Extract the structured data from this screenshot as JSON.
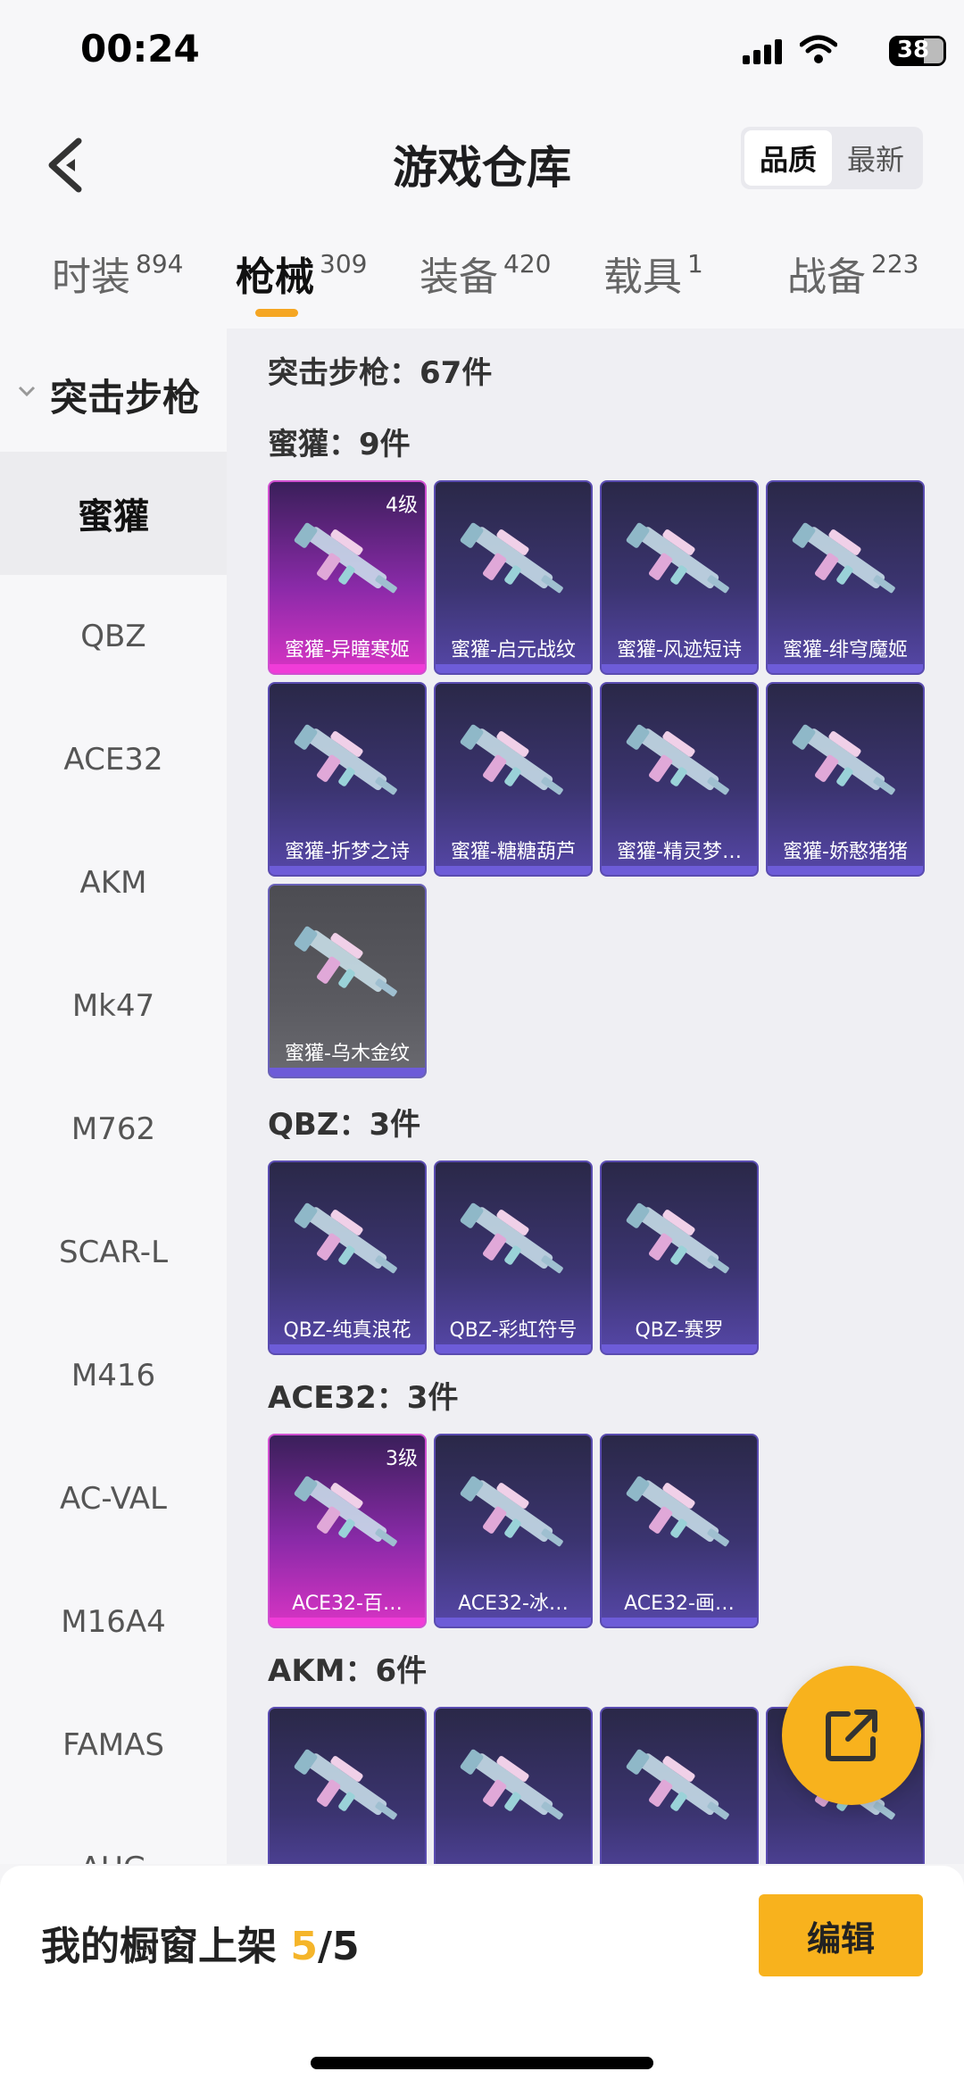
{
  "status_bar": {
    "time": "00:24",
    "battery": "38"
  },
  "header": {
    "title": "游戏仓库",
    "sort_options": [
      "品质",
      "最新"
    ],
    "sort_active": "品质"
  },
  "tabs": [
    {
      "label": "时装",
      "count": "894"
    },
    {
      "label": "枪械",
      "count": "309"
    },
    {
      "label": "装备",
      "count": "420"
    },
    {
      "label": "载具",
      "count": "1"
    },
    {
      "label": "战备",
      "count": "223"
    }
  ],
  "sidebar": {
    "category": "突击步枪",
    "items": [
      "蜜獾",
      "QBZ",
      "ACE32",
      "AKM",
      "Mk47",
      "M762",
      "SCAR-L",
      "M416",
      "AC-VAL",
      "M16A4",
      "FAMAS",
      "AUG"
    ]
  },
  "content": {
    "summary": "突击步枪：67件",
    "sections": [
      {
        "title": "蜜獾：9件",
        "items": [
          {
            "name": "蜜獾-异瞳寒姬",
            "level": "4级",
            "color": "#d834c4"
          },
          {
            "name": "蜜獾-启元战纹",
            "level": "",
            "color": "#5647a8"
          },
          {
            "name": "蜜獾-风迹短诗",
            "level": "",
            "color": "#5647a8"
          },
          {
            "name": "蜜獾-绯穹魔姬",
            "level": "",
            "color": "#5647a8"
          },
          {
            "name": "蜜獾-折梦之诗",
            "level": "",
            "color": "#5647a8"
          },
          {
            "name": "蜜獾-糖糖葫芦",
            "level": "",
            "color": "#5647a8"
          },
          {
            "name": "蜜獾-精灵梦…",
            "level": "",
            "color": "#5647a8"
          },
          {
            "name": "蜜獾-娇憨猪猪",
            "level": "",
            "color": "#5647a8"
          },
          {
            "name": "蜜獾-乌木金纹",
            "level": "",
            "color": "#5a5a60"
          }
        ]
      },
      {
        "title": "QBZ：3件",
        "items": [
          {
            "name": "QBZ-纯真浪花",
            "level": "",
            "color": "#5647a8"
          },
          {
            "name": "QBZ-彩虹符号",
            "level": "",
            "color": "#5647a8"
          },
          {
            "name": "QBZ-赛罗",
            "level": "",
            "color": "#5647a8"
          }
        ]
      },
      {
        "title": "ACE32：3件",
        "items": [
          {
            "name": "ACE32-百…",
            "level": "3级",
            "color": "#d834c4"
          },
          {
            "name": "ACE32-冰…",
            "level": "",
            "color": "#5647a8"
          },
          {
            "name": "ACE32-画…",
            "level": "",
            "color": "#5647a8"
          }
        ]
      },
      {
        "title": "AKM：6件",
        "items": [
          {
            "name": "",
            "level": "",
            "color": "#5647a8"
          },
          {
            "name": "",
            "level": "",
            "color": "#5647a8"
          },
          {
            "name": "",
            "level": "",
            "color": "#5647a8"
          },
          {
            "name": "",
            "level": "",
            "color": "#5647a8"
          }
        ]
      }
    ]
  },
  "showcase": {
    "label": "我的橱窗上架",
    "current": "5",
    "separator": "/",
    "total": "5"
  },
  "edit_label": "编辑",
  "icons": {
    "back": "back-arrow-icon",
    "fab": "share-export-icon",
    "chevron": "chevron-down-icon"
  }
}
